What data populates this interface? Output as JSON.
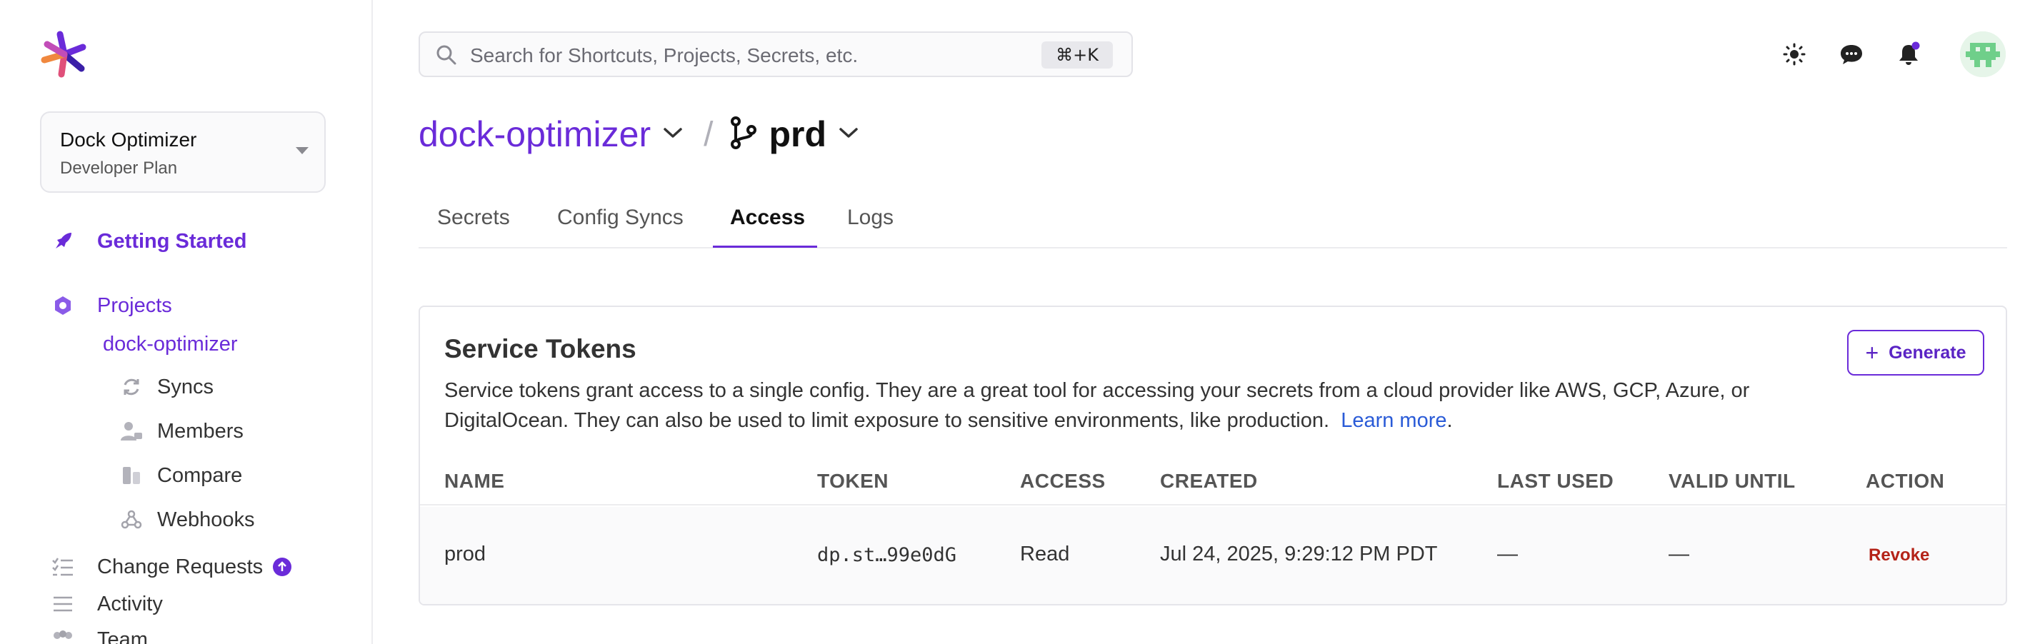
{
  "workspace": {
    "name": "Dock Optimizer",
    "plan": "Developer Plan"
  },
  "sidebar": {
    "getting_started": "Getting Started",
    "projects": "Projects",
    "project_name": "dock-optimizer",
    "sub_items": [
      "Syncs",
      "Members",
      "Compare",
      "Webhooks"
    ],
    "change_requests": "Change Requests",
    "activity": "Activity",
    "team": "Team"
  },
  "search": {
    "placeholder": "Search for Shortcuts, Projects, Secrets, etc.",
    "shortcut": "⌘+K"
  },
  "breadcrumb": {
    "project": "dock-optimizer",
    "separator": "/",
    "environment": "prd"
  },
  "tabs": [
    "Secrets",
    "Config Syncs",
    "Access",
    "Logs"
  ],
  "active_tab": "Access",
  "card": {
    "title": "Service Tokens",
    "description_1": "Service tokens grant access to a single config. They are a great tool for accessing your secrets from a cloud provider like AWS, GCP, Azure, or DigitalOcean. They can also be used to limit exposure to sensitive environments, like production.",
    "learn_more": "Learn more",
    "period": ".",
    "generate_label": "Generate",
    "generate_plus": "+"
  },
  "table": {
    "headers": [
      "NAME",
      "TOKEN",
      "ACCESS",
      "CREATED",
      "LAST USED",
      "VALID UNTIL",
      "ACTION"
    ],
    "rows": [
      {
        "name": "prod",
        "token": "dp.st…99e0dG",
        "access": "Read",
        "created": "Jul 24, 2025, 9:29:12 PM PDT",
        "last_used": "—",
        "valid_until": "—",
        "action": "Revoke"
      }
    ]
  },
  "colors": {
    "accent": "#6a2bd9",
    "danger": "#b42318",
    "link": "#2a5bd7"
  }
}
